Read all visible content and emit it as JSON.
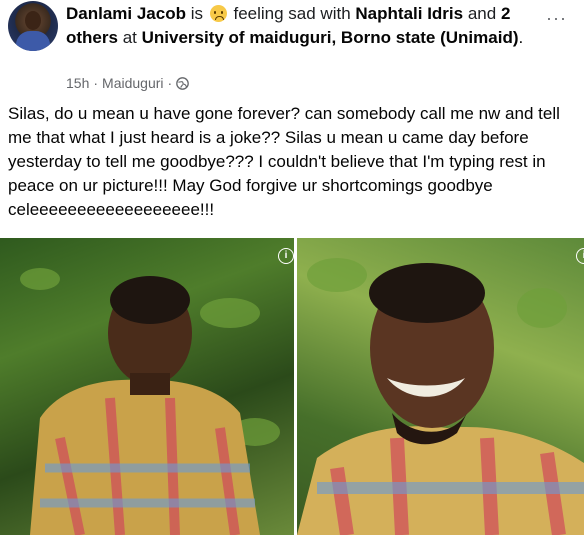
{
  "post": {
    "author": "Danlami Jacob",
    "is_text": "is",
    "feeling_text": "feeling sad with",
    "tagged": "Naphtali Idris",
    "and_text": "and",
    "others": "2 others",
    "at_text": "at",
    "location": "University of maiduguri, Borno state (Unimaid)",
    "period": ".",
    "time": "15h",
    "place": "Maiduguri",
    "separator": "·",
    "more_icon": "···",
    "text": "Silas, do u mean u have gone forever? can somebody call  me nw and tell me that what I just heard is a joke?? Silas u mean u came day before yesterday to tell me goodbye??? I couldn't believe that I'm typing rest in peace on ur picture!!! May God  forgive ur shortcomings goodbye celeeeeeeeeeeeeeeeeee!!!"
  },
  "icons": {
    "feeling": "sad-face-emoji",
    "privacy": "globe-icon",
    "more": "more-options-icon",
    "info": "info-icon"
  },
  "photos": [
    {
      "name": "photo-left"
    },
    {
      "name": "photo-right"
    }
  ]
}
